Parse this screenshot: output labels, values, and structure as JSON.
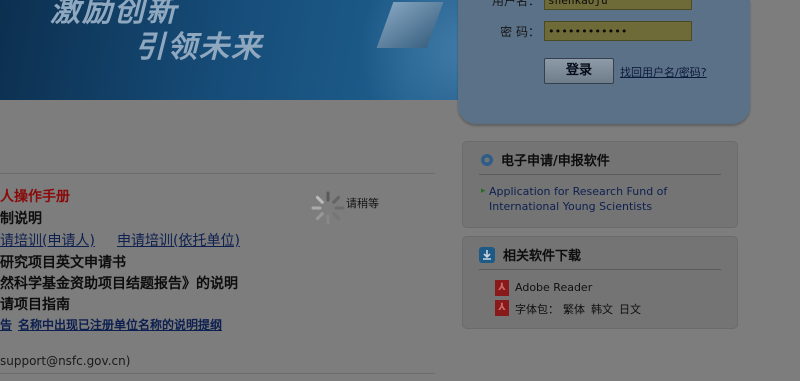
{
  "banner": {
    "slogan_line1": "激励创新",
    "slogan_line2": "引领未来"
  },
  "login": {
    "username_label": "用户名：",
    "username_value": "shenkaoju",
    "password_label": "密  码：",
    "password_value": "••••••••••••",
    "login_button": "登录",
    "forgot_link": "找回用户名/密码?"
  },
  "content": {
    "items": [
      "人操作手册",
      "制说明",
      "请培训(申请人)",
      "申请培训(依托单位)",
      "研究项目英文申请书",
      "然科学基金资助项目结题报告》的说明",
      "请项目指南",
      "告",
      "名称中出现已注册单位名称的说明提纲",
      "support@nsfc.gov.cn)"
    ]
  },
  "loading": {
    "text": "请稍等"
  },
  "software_panel": {
    "title": "电子申请/申报软件",
    "link": "Application for Research Fund of International Young Scientists"
  },
  "download_panel": {
    "title": "相关软件下载",
    "adobe": "Adobe Reader",
    "font_label": "字体包：",
    "font_options": [
      "繁体",
      "韩文",
      "日文"
    ]
  },
  "icons": {
    "gear": "gear-icon",
    "download": "download-icon",
    "pdf": "pdf-icon"
  }
}
